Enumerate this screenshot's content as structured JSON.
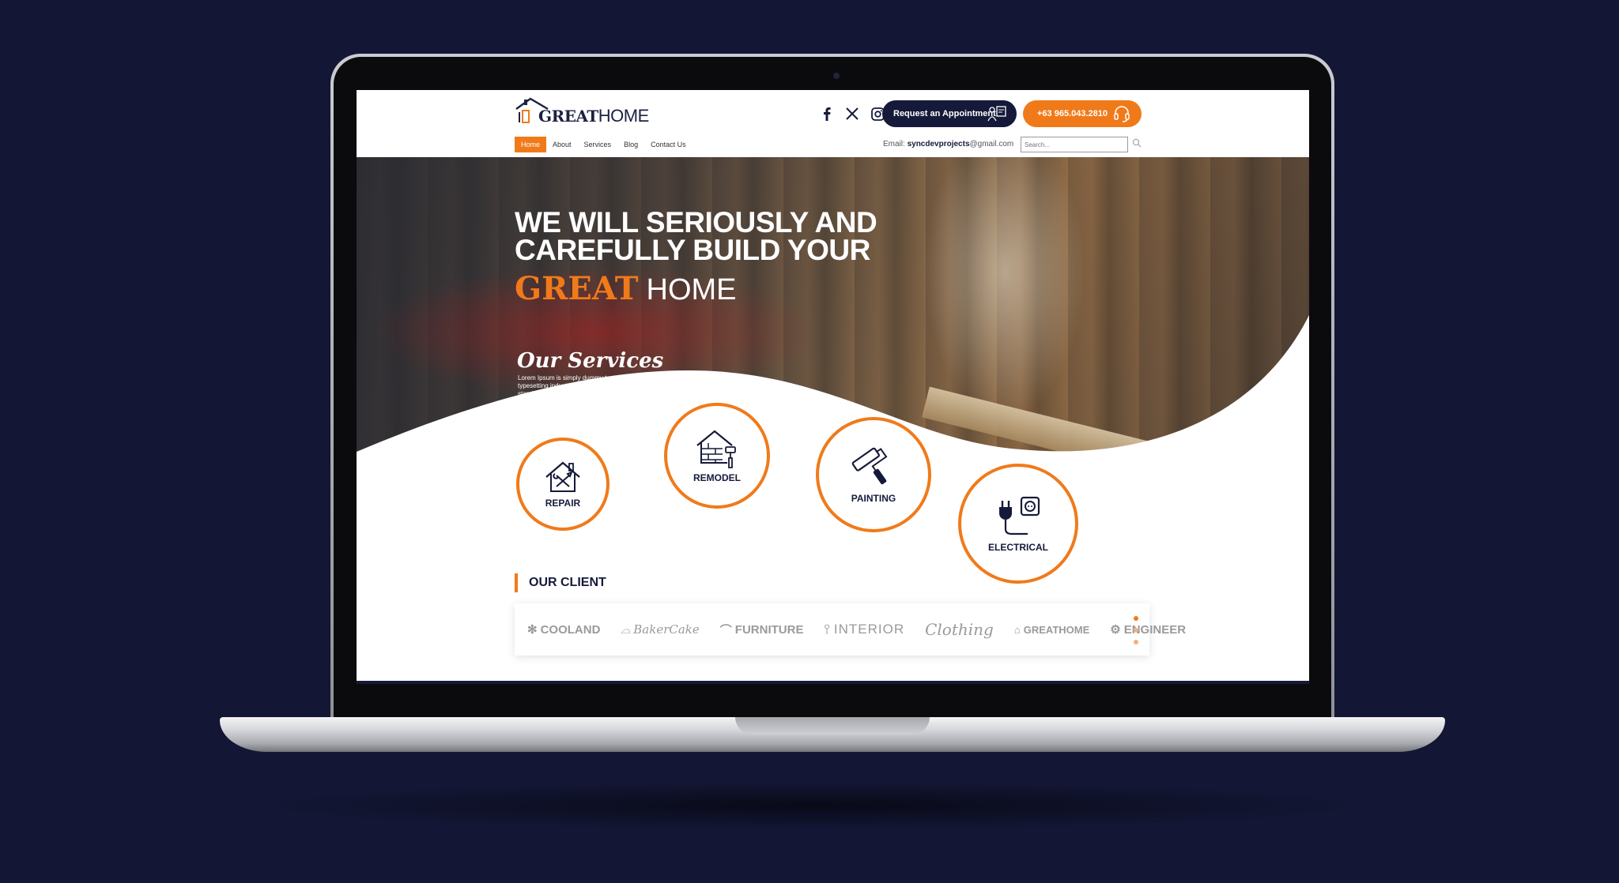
{
  "brand": {
    "great": "GREAT",
    "home": "HOME"
  },
  "header": {
    "social": [
      "facebook-icon",
      "x-icon",
      "instagram-icon"
    ],
    "appointment_label": "Request an Appointment",
    "phone_label": "+63 965.043.2810",
    "email_label": "Email:",
    "email_user": "syncdevprojects",
    "email_domain": "@gmail.com",
    "search_placeholder": "Search..."
  },
  "nav": {
    "items": [
      {
        "label": "Home",
        "active": true
      },
      {
        "label": "About",
        "active": false
      },
      {
        "label": "Services",
        "active": false
      },
      {
        "label": "Blog",
        "active": false
      },
      {
        "label": "Contact Us",
        "active": false
      }
    ]
  },
  "hero": {
    "line1": "WE WILL SERIOUSLY AND",
    "line2": "CAREFULLY BUILD YOUR",
    "brand_great": "GREAT",
    "brand_home": "HOME"
  },
  "services": {
    "title": "Our Services",
    "description": "Lorem Ipsum is simply dummy text of the printing and typesetting industry. Lorem Ipsum has been the industry's standard dummy.",
    "items": [
      {
        "label": "REPAIR",
        "icon": "house-tools-icon"
      },
      {
        "label": "REMODEL",
        "icon": "brick-house-icon"
      },
      {
        "label": "PAINTING",
        "icon": "paint-roller-icon"
      },
      {
        "label": "ELECTRICAL",
        "icon": "plug-outlet-icon"
      }
    ]
  },
  "clients": {
    "title": "OUR CLIENT",
    "logos": [
      "COOLAND",
      "BakerCake",
      "FURNITURE",
      "INTERIOR",
      "Clothing",
      "GREATHOME",
      "ENGINEER"
    ]
  },
  "colors": {
    "accent": "#f07a1a",
    "navy": "#151a3a",
    "background": "#131634"
  }
}
